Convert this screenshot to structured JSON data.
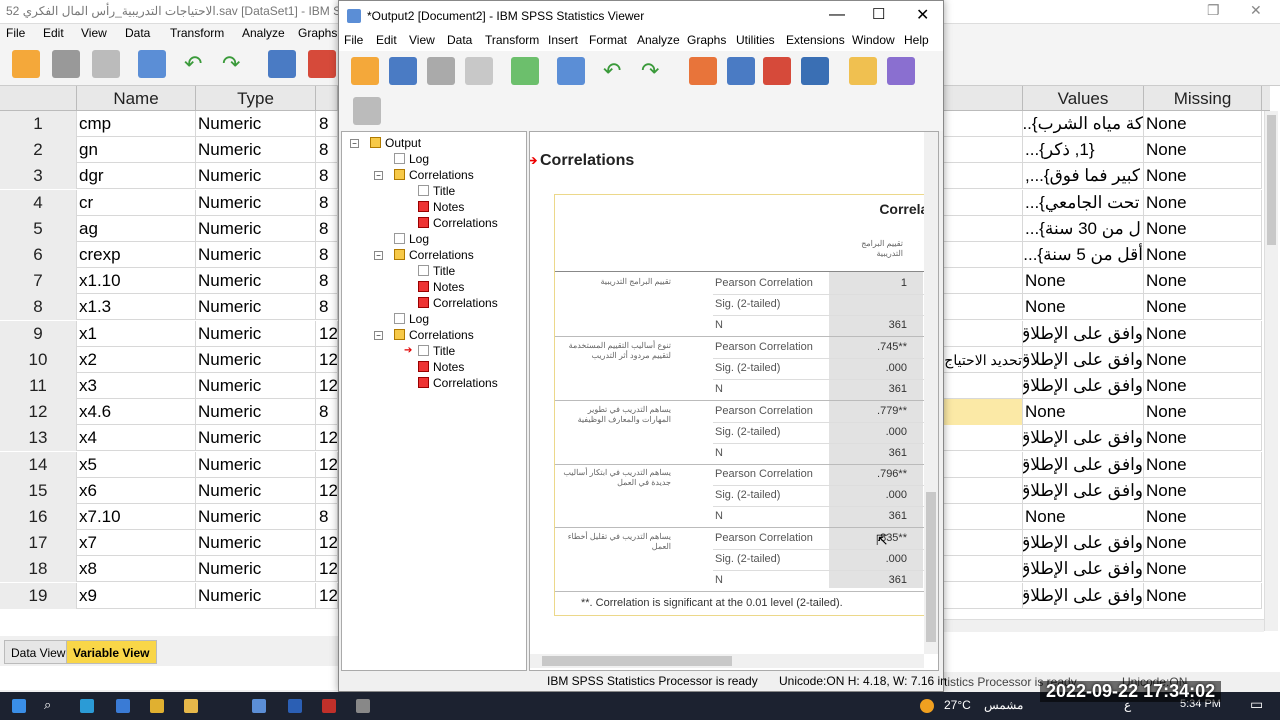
{
  "editor": {
    "title": "الاحتياجات التدريبية_رأس المال الفكري 52.sav [DataSet1] - IBM SPSS",
    "menu": [
      "File",
      "Edit",
      "View",
      "Data",
      "Transform",
      "Analyze",
      "Graphs"
    ],
    "headers": {
      "row": "",
      "name": "Name",
      "type": "Type",
      "values": "Values",
      "missing": "Missing"
    },
    "rows": [
      {
        "n": "1",
        "name": "cmp",
        "type": "Numeric",
        "width": "8",
        "values": "كة مياه الشرب}......",
        "missing": "None",
        "extra": ""
      },
      {
        "n": "2",
        "name": "gn",
        "type": "Numeric",
        "width": "8",
        "values": "{1, ذكر}...",
        "missing": "None",
        "extra": ""
      },
      {
        "n": "3",
        "name": "dgr",
        "type": "Numeric",
        "width": "8",
        "values": "كبير فما فوق}...,",
        "missing": "None",
        "extra": ""
      },
      {
        "n": "4",
        "name": "cr",
        "type": "Numeric",
        "width": "8",
        "values": "تحت الجامعي}...",
        "missing": "None",
        "extra": ""
      },
      {
        "n": "5",
        "name": "ag",
        "type": "Numeric",
        "width": "8",
        "values": "ل من 30 سنة}...",
        "missing": "None",
        "extra": ""
      },
      {
        "n": "6",
        "name": "crexp",
        "type": "Numeric",
        "width": "8",
        "values": "أقل من 5 سنة}...",
        "missing": "None",
        "extra": ""
      },
      {
        "n": "7",
        "name": "x1.10",
        "type": "Numeric",
        "width": "8",
        "values": "None",
        "missing": "None",
        "extra": ""
      },
      {
        "n": "8",
        "name": "x1.3",
        "type": "Numeric",
        "width": "8",
        "values": "None",
        "missing": "None",
        "extra": ""
      },
      {
        "n": "9",
        "name": "x1",
        "type": "Numeric",
        "width": "12",
        "values": "وافق على الإطلاق...",
        "missing": "None",
        "extra": ""
      },
      {
        "n": "10",
        "name": "x2",
        "type": "Numeric",
        "width": "12",
        "values": "وافق على الإطلاق...",
        "missing": "None",
        "extra": "تحديد الاحتياج"
      },
      {
        "n": "11",
        "name": "x3",
        "type": "Numeric",
        "width": "12",
        "values": "وافق على الإطلاق...",
        "missing": "None",
        "extra": ""
      },
      {
        "n": "12",
        "name": "x4.6",
        "type": "Numeric",
        "width": "8",
        "values": "None",
        "missing": "None",
        "extra": ""
      },
      {
        "n": "13",
        "name": "x4",
        "type": "Numeric",
        "width": "12",
        "values": "وافق على الإطلاق...",
        "missing": "None",
        "extra": ""
      },
      {
        "n": "14",
        "name": "x5",
        "type": "Numeric",
        "width": "12",
        "values": "وافق على الإطلاق...",
        "missing": "None",
        "extra": ""
      },
      {
        "n": "15",
        "name": "x6",
        "type": "Numeric",
        "width": "12",
        "values": "وافق على الإطلاق...",
        "missing": "None",
        "extra": ""
      },
      {
        "n": "16",
        "name": "x7.10",
        "type": "Numeric",
        "width": "8",
        "values": "None",
        "missing": "None",
        "extra": ""
      },
      {
        "n": "17",
        "name": "x7",
        "type": "Numeric",
        "width": "12",
        "values": "وافق على الإطلاق...",
        "missing": "None",
        "extra": ""
      },
      {
        "n": "18",
        "name": "x8",
        "type": "Numeric",
        "width": "12",
        "values": "وافق على الإطلاق...",
        "missing": "None",
        "extra": ""
      },
      {
        "n": "19",
        "name": "x9",
        "type": "Numeric",
        "width": "12",
        "values": "وافق على الإطلاق...",
        "missing": "None",
        "extra": ""
      }
    ],
    "tabs": {
      "data_view": "Data View",
      "variable_view": "Variable View"
    },
    "status": "tistics Processor is ready",
    "status2": "Unicode:ON"
  },
  "viewer": {
    "title": "*Output2 [Document2] - IBM SPSS Statistics Viewer",
    "menu": [
      "File",
      "Edit",
      "View",
      "Data",
      "Transform",
      "Insert",
      "Format",
      "Analyze",
      "Graphs",
      "Utilities",
      "Extensions",
      "Window",
      "Help"
    ],
    "outline": {
      "root": "Output",
      "items": [
        {
          "label": "Log",
          "level": 1
        },
        {
          "label": "Correlations",
          "level": 1
        },
        {
          "label": "Title",
          "level": 2
        },
        {
          "label": "Notes",
          "level": 2
        },
        {
          "label": "Correlations",
          "level": 2
        },
        {
          "label": "Log",
          "level": 1
        },
        {
          "label": "Correlations",
          "level": 1
        },
        {
          "label": "Title",
          "level": 2
        },
        {
          "label": "Notes",
          "level": 2
        },
        {
          "label": "Correlations",
          "level": 2
        },
        {
          "label": "Log",
          "level": 1
        },
        {
          "label": "Correlations",
          "level": 1
        },
        {
          "label": "Title",
          "level": 2
        },
        {
          "label": "Notes",
          "level": 2
        },
        {
          "label": "Correlations",
          "level": 2
        }
      ]
    },
    "content": {
      "heading": "Correlations",
      "table_title": "Correlat",
      "col_header": "تقييم البرامج التدريبية",
      "groups": [
        {
          "label": "تقييم البرامج التدريبية",
          "pearson_label": "Pearson Correlation",
          "pearson": "1",
          "sig_label": "Sig. (2-tailed)",
          "sig": "",
          "n_label": "N",
          "n": "361"
        },
        {
          "label": "تنوع أساليب التقييم المستخدمة لتقييم مردود أثر التدريب",
          "pearson_label": "Pearson Correlation",
          "pearson": ".745**",
          "sig_label": "Sig. (2-tailed)",
          "sig": ".000",
          "n_label": "N",
          "n": "361"
        },
        {
          "label": "يساهم التدريب في تطوير المهارات والمعارف الوظيفية",
          "pearson_label": "Pearson Correlation",
          "pearson": ".779**",
          "sig_label": "Sig. (2-tailed)",
          "sig": ".000",
          "n_label": "N",
          "n": "361"
        },
        {
          "label": "يساهم التدريب في ابتكار أساليب جديدة في العمل",
          "pearson_label": "Pearson Correlation",
          "pearson": ".796**",
          "sig_label": "Sig. (2-tailed)",
          "sig": ".000",
          "n_label": "N",
          "n": "361"
        },
        {
          "label": "يساهم التدريب في تقليل أخطاء العمل",
          "pearson_label": "Pearson Correlation",
          "pearson": ".835**",
          "sig_label": "Sig. (2-tailed)",
          "sig": ".000",
          "n_label": "N",
          "n": "361"
        }
      ],
      "footnote": "**. Correlation is significant at the 0.01 level (2-tailed)."
    },
    "status_processor": "IBM SPSS Statistics Processor is ready",
    "status_info": "Unicode:ON  H: 4.18, W: 7.16 in"
  },
  "taskbar": {
    "weather": "27°C",
    "weather_text": "مشمس",
    "time": "5:34 PM",
    "lang": "ع"
  },
  "overlay_clock": "2022-09-22 17:34:02",
  "colors": {
    "accent": "#e30000",
    "selected_tab": "#f9d648",
    "highlight_row": "#fbe9a6"
  }
}
